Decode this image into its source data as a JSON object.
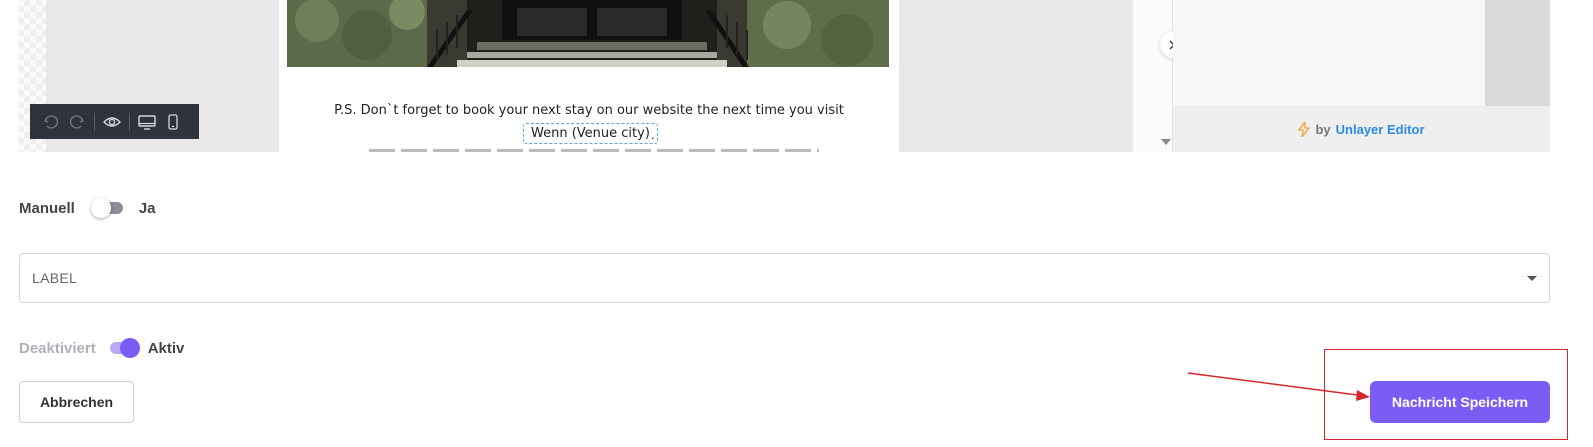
{
  "editor": {
    "ps_text": "P.S. Don`t forget to book your next stay on our website the next time you visit",
    "merge_tag": "Wenn (Venue city)",
    "merge_suffix": ".",
    "toolbar_icons": [
      "undo-icon",
      "redo-icon",
      "eye-icon",
      "desktop-icon",
      "mobile-icon"
    ],
    "footer": {
      "bolt_icon": "bolt-icon",
      "by": "by",
      "brand": "Unlayer Editor",
      "brand_color": "#2a8ae8"
    }
  },
  "form": {
    "manual_toggle": {
      "left_label": "Manuell",
      "right_label": "Ja",
      "on": false
    },
    "label_select": {
      "placeholder": "LABEL"
    },
    "active_toggle": {
      "left_label": "Deaktiviert",
      "right_label": "Aktiv",
      "on": true,
      "accent": "#7b5cf5"
    },
    "cancel_label": "Abbrechen",
    "save_label": "Nachricht Speichern"
  },
  "annotation": {
    "color": "#d7262e"
  }
}
